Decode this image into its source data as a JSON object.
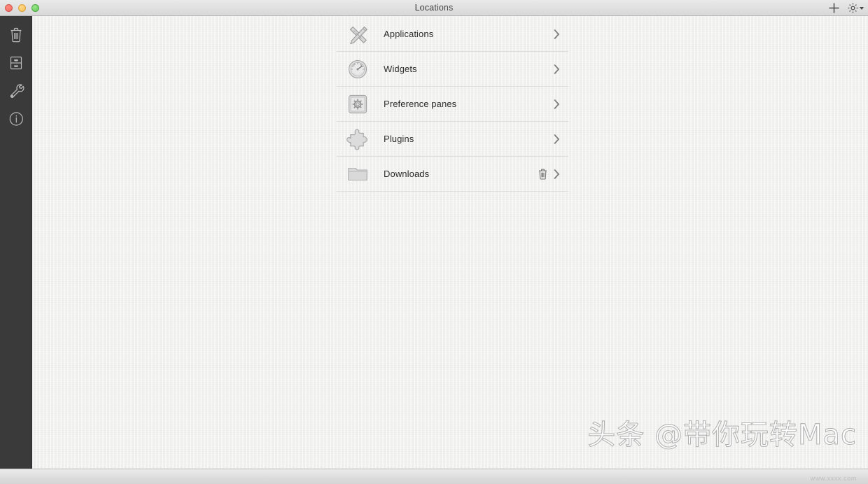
{
  "window": {
    "title": "Locations",
    "traffic_lights": [
      {
        "name": "close",
        "color": "#ec6a5e"
      },
      {
        "name": "minimize",
        "color": "#f5bd4f"
      },
      {
        "name": "maximize",
        "color": "#61c555"
      }
    ],
    "toolbar_right": [
      {
        "name": "add-button",
        "icon": "plus-icon",
        "label": "+"
      },
      {
        "name": "settings-button",
        "icon": "gear-icon",
        "label": "⚙",
        "has_caret": true
      }
    ]
  },
  "sidebar": {
    "background": "#3a3a3a",
    "items": [
      {
        "name": "sidebar-item-uninstaller",
        "icon": "trash-icon",
        "label": "Uninstaller"
      },
      {
        "name": "sidebar-item-files",
        "icon": "drawers-icon",
        "label": "Files"
      },
      {
        "name": "sidebar-item-tools",
        "icon": "wrench-icon",
        "label": "Tools"
      },
      {
        "name": "sidebar-item-info",
        "icon": "info-icon",
        "label": "Info"
      }
    ]
  },
  "main": {
    "rows": [
      {
        "icon": "applications-icon",
        "label": "Applications",
        "has_trash": false,
        "has_chevron": true
      },
      {
        "icon": "widgets-icon",
        "label": "Widgets",
        "has_trash": false,
        "has_chevron": true
      },
      {
        "icon": "preference-panes-icon",
        "label": "Preference panes",
        "has_trash": false,
        "has_chevron": true
      },
      {
        "icon": "plugins-icon",
        "label": "Plugins",
        "has_trash": false,
        "has_chevron": true
      },
      {
        "icon": "downloads-icon",
        "label": "Downloads",
        "has_trash": true,
        "has_chevron": true
      }
    ]
  },
  "watermark": {
    "main": "头条 @带你玩转Mac",
    "small": "www.xxxx.com"
  }
}
